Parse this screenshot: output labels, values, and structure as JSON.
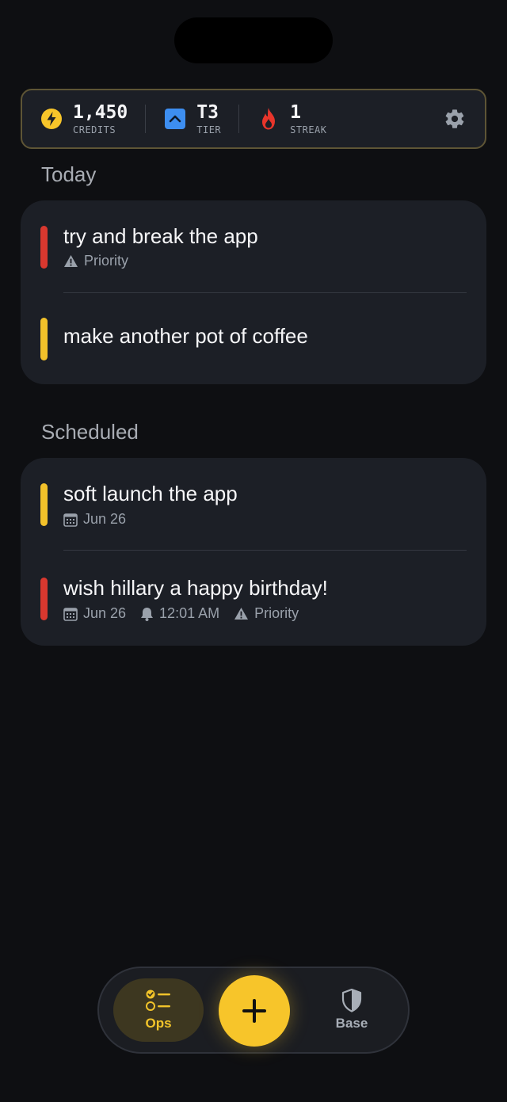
{
  "stats": {
    "credits": {
      "value": "1,450",
      "label": "CREDITS",
      "icon": "lightning-icon"
    },
    "tier": {
      "value": "T3",
      "label": "TIER",
      "icon": "chevron-up-icon"
    },
    "streak": {
      "value": "1",
      "label": "STREAK",
      "icon": "flame-icon"
    },
    "settings_icon": "gear-icon"
  },
  "today": {
    "title": "Today",
    "tasks": [
      {
        "title": "try and break the app",
        "priority": "Priority",
        "color": "#d9382f"
      },
      {
        "title": "make another pot of coffee",
        "color": "#f2c12a"
      }
    ]
  },
  "scheduled": {
    "title": "Scheduled",
    "tasks": [
      {
        "title": "soft launch the app",
        "date": "Jun 26",
        "color": "#f2c12a"
      },
      {
        "title": "wish hillary a happy birthday!",
        "date": "Jun 26",
        "time": "12:01 AM",
        "priority": "Priority",
        "color": "#d9382f"
      }
    ]
  },
  "nav": {
    "ops_label": "Ops",
    "base_label": "Base",
    "add_icon": "plus-icon"
  },
  "colors": {
    "accent": "#f7c52a",
    "background": "#0e0f12",
    "card": "#1c1f26",
    "priority_red": "#d9382f",
    "tier_blue": "#3d8ef0"
  }
}
